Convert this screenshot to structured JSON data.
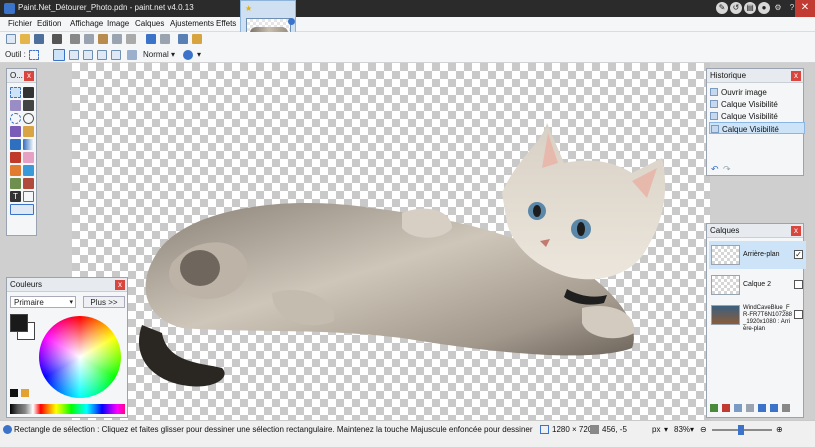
{
  "window": {
    "title": "Paint.Net_Détourer_Photo.pdn - paint.net v4.0.13"
  },
  "menu": {
    "items": [
      "Fichier",
      "Edition",
      "Affichage",
      "Image",
      "Calques",
      "Ajustements",
      "Effets"
    ]
  },
  "toolbar": {
    "tool_label": "Outil :",
    "blend_mode": "Normal"
  },
  "tools_panel": {
    "title": "O..."
  },
  "colors_panel": {
    "title": "Couleurs",
    "mode_select": "Primaire",
    "more_button": "Plus >>",
    "primary_color": "#1a1a1a",
    "secondary_color": "#ffffff"
  },
  "history_panel": {
    "title": "Historique",
    "items": [
      "Ouvrir image",
      "Calque Visibilité",
      "Calque Visibilité",
      "Calque Visibilité"
    ],
    "selected_index": 3
  },
  "layers_panel": {
    "title": "Calques",
    "layers": [
      {
        "name": "Arrière-plan",
        "visible": true,
        "selected": true
      },
      {
        "name": "Calque 2",
        "visible": false,
        "selected": false
      },
      {
        "name": "WindCaveBlue_FR-FR7T6N107288_1920x1080 : Arrière-plan",
        "visible": false,
        "selected": false
      }
    ]
  },
  "statusbar": {
    "hint": "Rectangle de sélection : Cliquez et faites glisser pour dessiner une sélection rectangulaire. Maintenez la touche Majuscule enfoncée pour dessiner un carré.",
    "image_size": "1280 × 720",
    "cursor_pos": "456, -5",
    "unit": "px",
    "zoom": "83%"
  },
  "colors": {
    "accent": "#3a73c9",
    "close_red": "#d9463e",
    "selection_blue": "#cde3f7"
  }
}
